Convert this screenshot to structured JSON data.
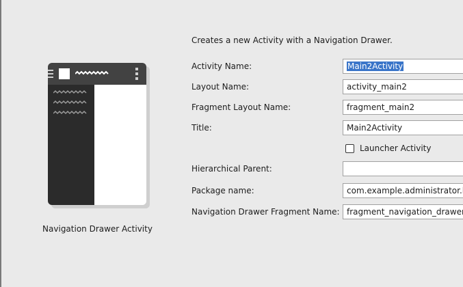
{
  "template": {
    "description": "Creates a new Activity with a Navigation Drawer.",
    "preview_caption": "Navigation Drawer Activity"
  },
  "form": {
    "activity_name": {
      "label": "Activity Name:",
      "value": "Main2Activity"
    },
    "layout_name": {
      "label": "Layout Name:",
      "value": "activity_main2"
    },
    "fragment_layout_name": {
      "label": "Fragment Layout Name:",
      "value": "fragment_main2"
    },
    "title": {
      "label": "Title:",
      "value": "Main2Activity"
    },
    "launcher_activity": {
      "label": "Launcher Activity",
      "checked": false
    },
    "hierarchical_parent": {
      "label": "Hierarchical Parent:",
      "value": ""
    },
    "package_name": {
      "label": "Package name:",
      "value": "com.example.administrator.le"
    },
    "nav_drawer_fragment_name": {
      "label": "Navigation Drawer Fragment Name:",
      "value": "fragment_navigation_drawer"
    }
  },
  "colors": {
    "background": "#eaeaea",
    "selection": "#3a75c9",
    "toolbar": "#424242",
    "drawer": "#2b2b2b"
  },
  "icons": {
    "hamburger": "hamburger-icon",
    "overflow_menu": "overflow-menu-icon"
  }
}
